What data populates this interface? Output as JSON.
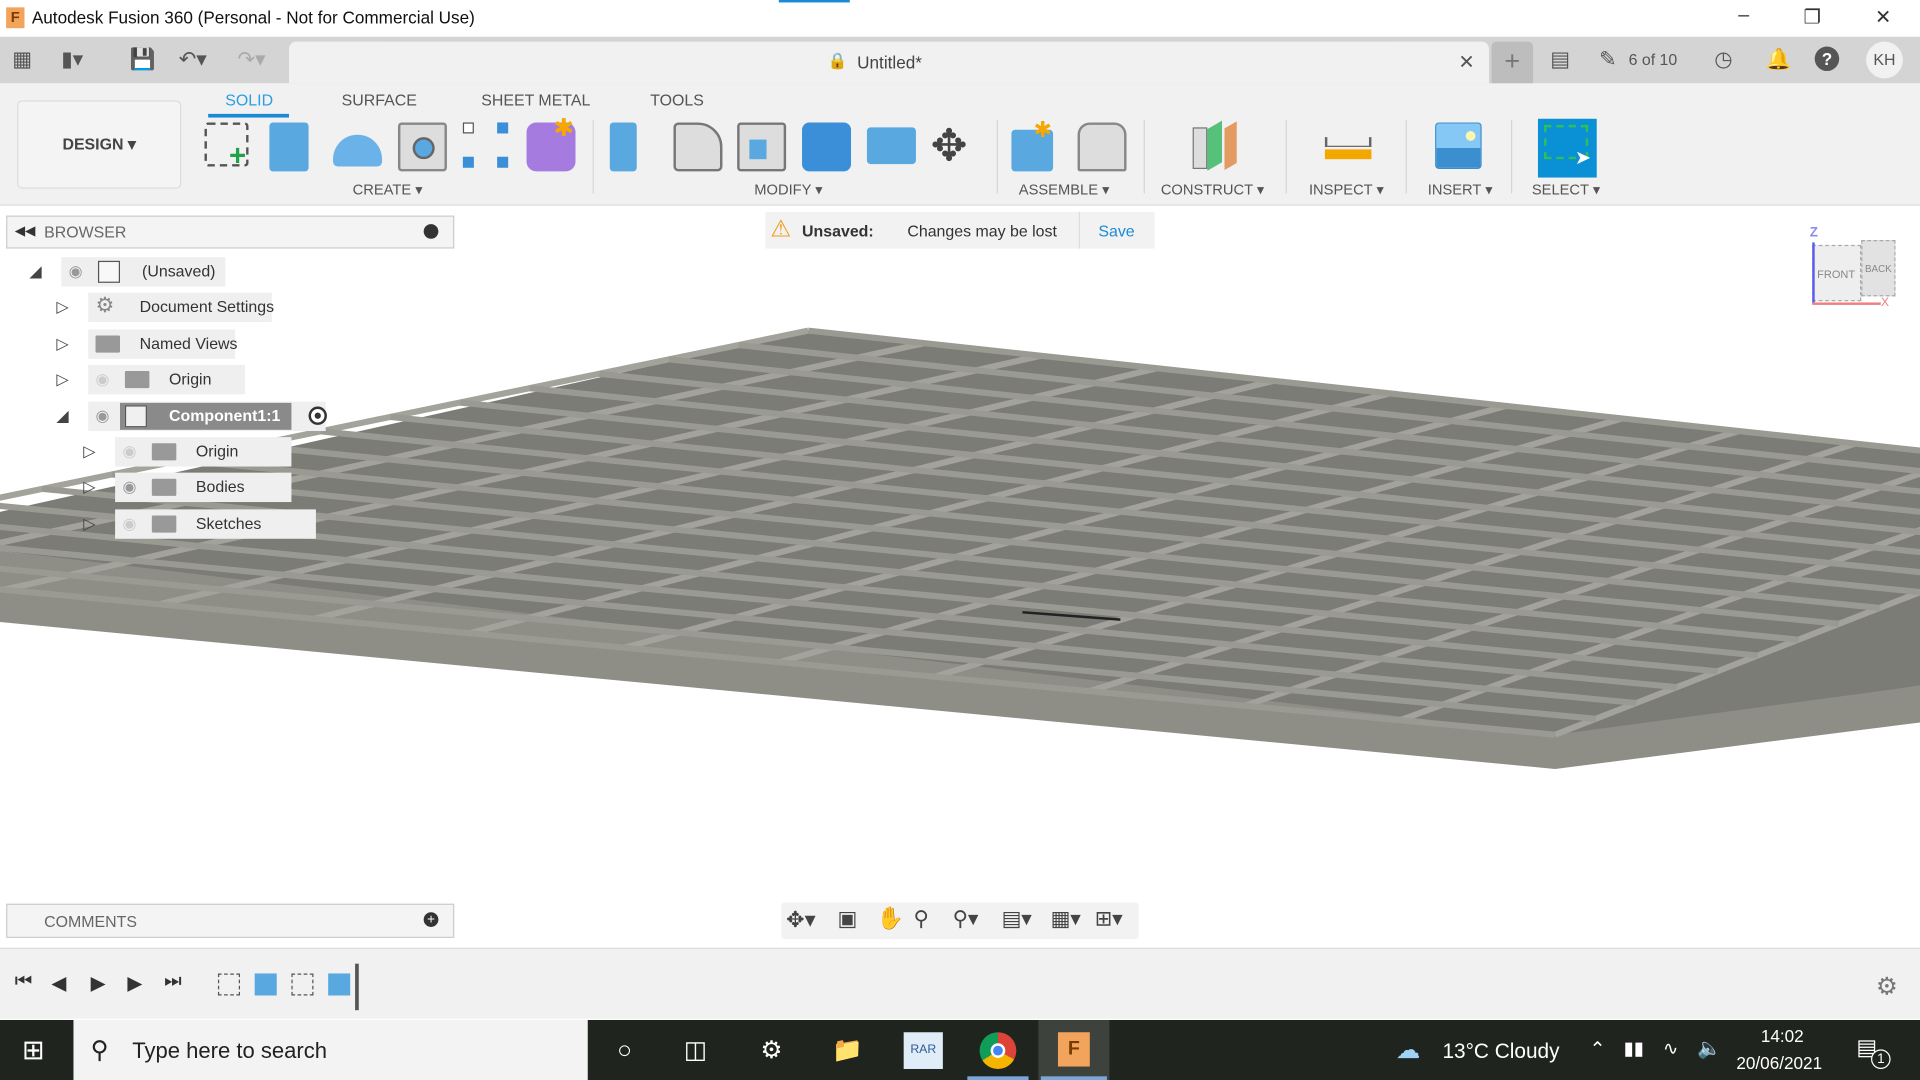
{
  "window": {
    "title": "Autodesk Fusion 360 (Personal - Not for Commercial Use)",
    "app_logo": "F"
  },
  "qat": {
    "doc_title": "Untitled*",
    "jobs": "6 of 10",
    "avatar": "KH"
  },
  "ribbon": {
    "workspace": "DESIGN",
    "tabs": [
      {
        "label": "SOLID",
        "active": true
      },
      {
        "label": "SURFACE"
      },
      {
        "label": "SHEET METAL"
      },
      {
        "label": "TOOLS"
      }
    ],
    "groups": [
      "CREATE",
      "MODIFY",
      "ASSEMBLE",
      "CONSTRUCT",
      "INSPECT",
      "INSERT",
      "SELECT"
    ]
  },
  "browser": {
    "title": "BROWSER",
    "nodes": [
      {
        "label": "(Unsaved)"
      },
      {
        "label": "Document Settings"
      },
      {
        "label": "Named Views"
      },
      {
        "label": "Origin"
      },
      {
        "label": "Component1:1"
      },
      {
        "label": "Origin"
      },
      {
        "label": "Bodies"
      },
      {
        "label": "Sketches"
      }
    ]
  },
  "notice": {
    "title": "Unsaved:",
    "message": "Changes may be lost",
    "action": "Save"
  },
  "viewcube": {
    "front": "FRONT",
    "back": "BACK",
    "z": "Z",
    "x": "X"
  },
  "comments": {
    "title": "COMMENTS"
  },
  "taskbar": {
    "search_placeholder": "Type here to search",
    "weather": "13°C  Cloudy",
    "time": "14:02",
    "date": "20/06/2021",
    "notifications": "1"
  },
  "colors": {
    "accent": "#1a8ad4",
    "model": "#8f8f88",
    "taskbar": "#20241f"
  }
}
